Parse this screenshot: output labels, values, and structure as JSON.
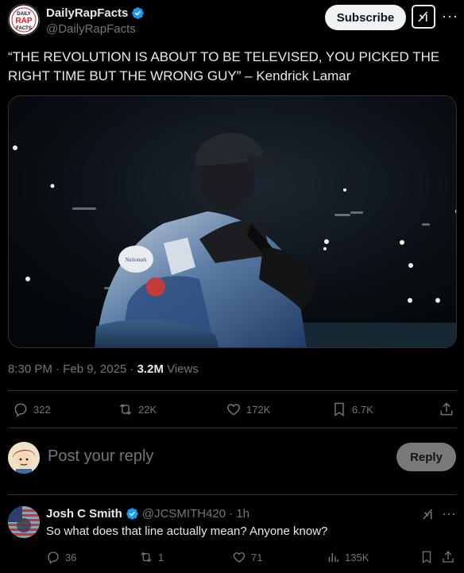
{
  "author": {
    "name": "DailyRapFacts",
    "handle": "@DailyRapFacts",
    "logo_text": [
      "DAILY",
      "RAP",
      "FACTS"
    ]
  },
  "header_actions": {
    "subscribe_label": "Subscribe",
    "grok_icon": "grok-icon",
    "more_icon": "more-icon"
  },
  "tweet": {
    "text": "“THE REVOLUTION IS ABOUT TO BE TELEVISED, YOU PICKED THE RIGHT TIME BUT THE WRONG GUY” – Kendrick Lamar",
    "time": "8:30 PM · Feb 9, 2025 · ",
    "views_count": "3.2M",
    "views_label": " Views"
  },
  "actions": {
    "replies": "322",
    "reposts": "22K",
    "likes": "172K",
    "bookmarks": "6.7K"
  },
  "reply_box": {
    "placeholder": "Post your reply",
    "button_label": "Reply"
  },
  "comment": {
    "name": "Josh C Smith",
    "handle": "@JCSMITH420",
    "time": "· 1h",
    "text": "So what does that line actually mean? Anyone know?",
    "replies": "36",
    "reposts": "1",
    "likes": "71",
    "views": "135K"
  },
  "colors": {
    "background": "#000000",
    "text": "#e7e9ea",
    "muted": "#71767b",
    "verified": "#1d9bf0",
    "border": "#2f3336"
  }
}
